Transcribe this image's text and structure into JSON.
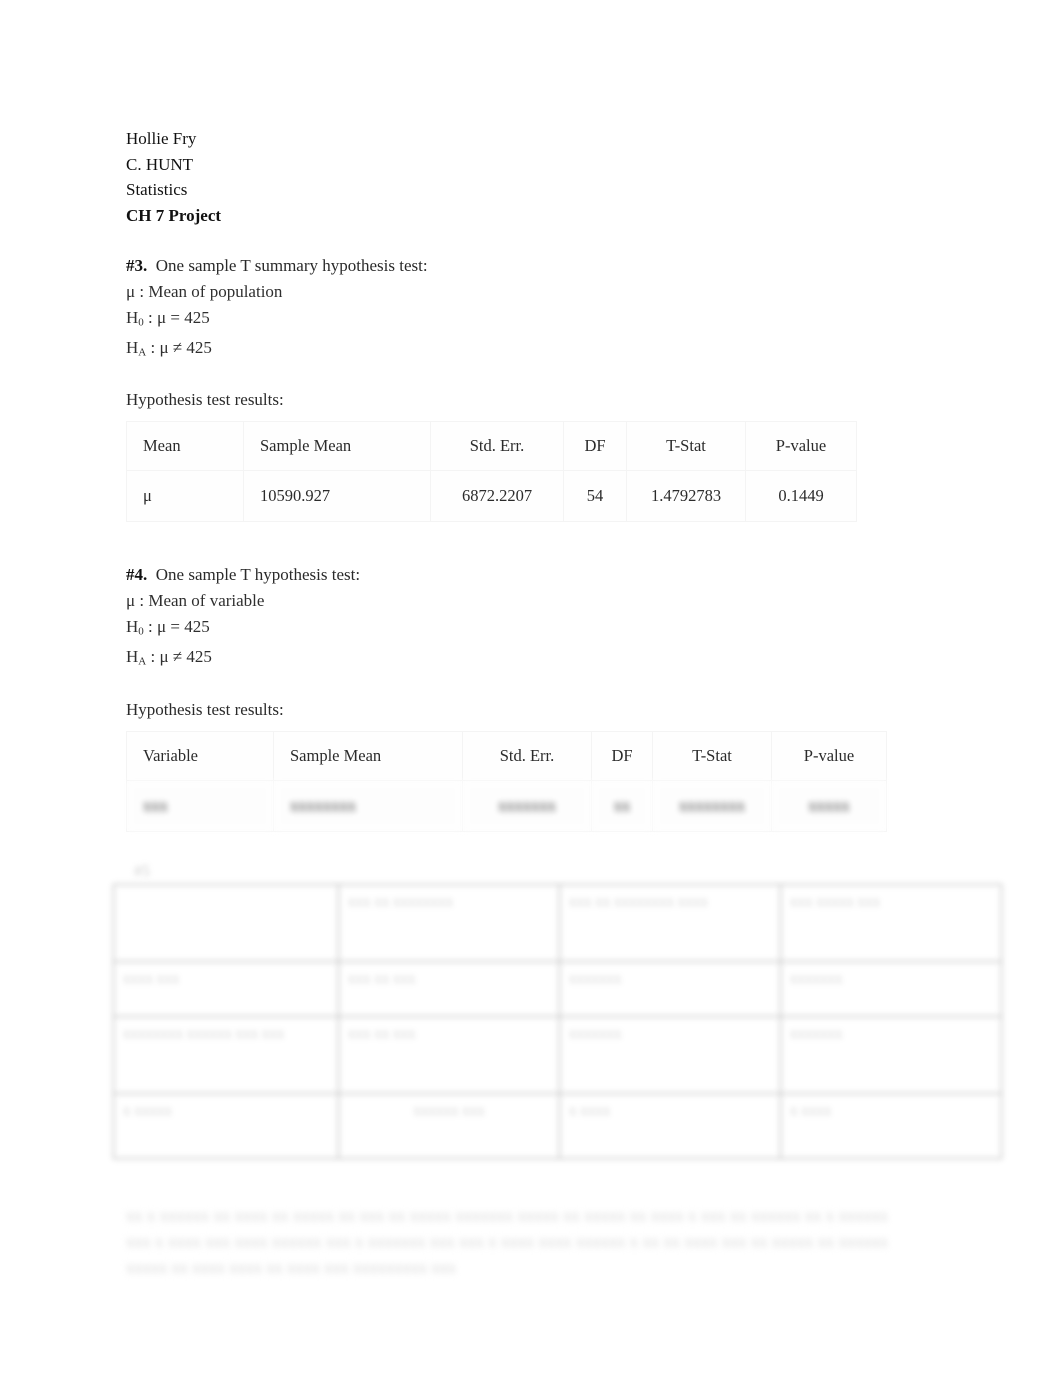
{
  "document": {
    "header": {
      "student_name": "Hollie Fry",
      "instructor": "C. HUNT",
      "course": "Statistics",
      "assignment": "CH 7 Project"
    },
    "sections": [
      {
        "number": "#3.",
        "title": "One sample T summary hypothesis test:",
        "parameter": "μ : Mean of population",
        "null_hypothesis": {
          "symbol": "H",
          "subscript": "0",
          "statement": " : μ = 425"
        },
        "alt_hypothesis": {
          "symbol": "H",
          "subscript": "A",
          "statement": " : μ ≠ 425"
        },
        "results_label": "Hypothesis test results:",
        "table": {
          "headers": [
            "Mean",
            "Sample Mean",
            "Std. Err.",
            "DF",
            "T-Stat",
            "P-value"
          ],
          "rows": [
            [
              "μ",
              "10590.927",
              "6872.2207",
              "54",
              "1.4792783",
              "0.1449"
            ]
          ]
        }
      },
      {
        "number": "#4.",
        "title": "One sample T hypothesis test:",
        "parameter": "μ : Mean of variable",
        "null_hypothesis": {
          "symbol": "H",
          "subscript": "0",
          "statement": " : μ = 425"
        },
        "alt_hypothesis": {
          "symbol": "H",
          "subscript": "A",
          "statement": " : μ ≠ 425"
        },
        "results_label": "Hypothesis test results:",
        "table": {
          "headers": [
            "Variable",
            "Sample Mean",
            "Std. Err.",
            "DF",
            "T-Stat",
            "P-value"
          ],
          "rows": [
            [
              "xxx",
              "xxxxxxxx",
              "xxxxxxx",
              "xx",
              "xxxxxxxx",
              "xxxxx"
            ]
          ],
          "row_state": "illegible"
        }
      }
    ],
    "question_five": {
      "label": "#5",
      "state": "illegible",
      "table": {
        "rows": [
          [
            "",
            "xxx xx xxxxxxxx",
            "xxx xx xxxxxxxx xxxx",
            "xxx xxxxx xxx"
          ],
          [
            "xxxx xxx",
            "xxx xx xxx",
            "xxxxxxx",
            "xxxxxxx"
          ],
          [
            "xxxxxxxx xxxxxx xxx xxx",
            "xxx xx xxx",
            "xxxxxxx",
            "xxxxxxx"
          ],
          [
            "x xxxxx",
            "xxxxxx xxx",
            "x xxxx",
            "x xxxx"
          ]
        ]
      }
    },
    "closing_paragraph": {
      "state": "illegible",
      "text": "xx x xxxxxx xx xxxx xx xxxxx xx xxx xx xxxxx xxxxxxx xxxxx xx xxxxx xx xxxx x xxx xx xxxxxx xx x xxxxxx xxx x xxxx xxx xxxx xxxxxx xxx x xxxxxxx xxx xxx x xxxx xxxx xxxxxx x xx xx xxxx xxx xx xxxxx xx xxxxxx xxxxx xx xxxx xxxx xx xxxx xxx xxxxxxxxx xxx"
    }
  }
}
